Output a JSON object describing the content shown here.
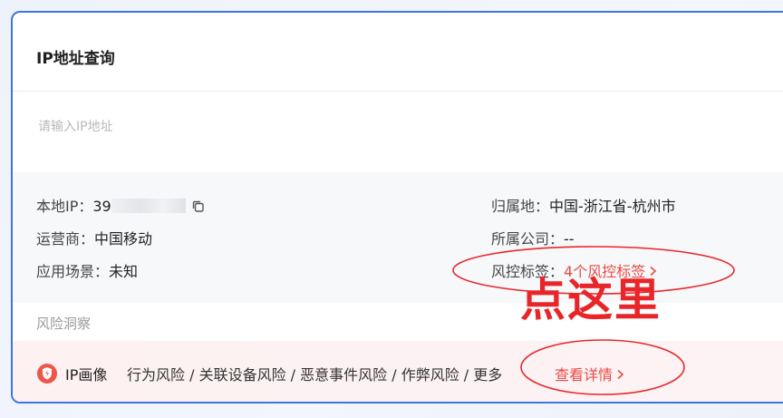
{
  "card": {
    "title": "IP地址查询"
  },
  "search": {
    "placeholder": "请输入IP地址",
    "value": ""
  },
  "info": {
    "local_ip_label": "本地IP：",
    "local_ip_value": "39",
    "isp_label": "运营商：",
    "isp_value": "中国移动",
    "scene_label": "应用场景：",
    "scene_value": "未知",
    "location_label": "归属地：",
    "location_value": "中国-浙江省-杭州市",
    "company_label": "所属公司：",
    "company_value": "--",
    "risk_tag_label": "风控标签：",
    "risk_tag_value": "4个风控标签"
  },
  "risk_section": {
    "title": "风险洞察"
  },
  "portrait": {
    "title": "IP画像",
    "items": "行为风险 / 关联设备风险 / 恶意事件风险 / 作弊风险 / 更多",
    "detail_link": "查看详情"
  },
  "annotation": {
    "text": "点这里"
  },
  "colors": {
    "accent": "#3f74e0",
    "danger": "#e94b44",
    "annotation": "#e8262a"
  },
  "icons": [
    "copy-icon",
    "chevron-right-icon",
    "shield-icon"
  ]
}
